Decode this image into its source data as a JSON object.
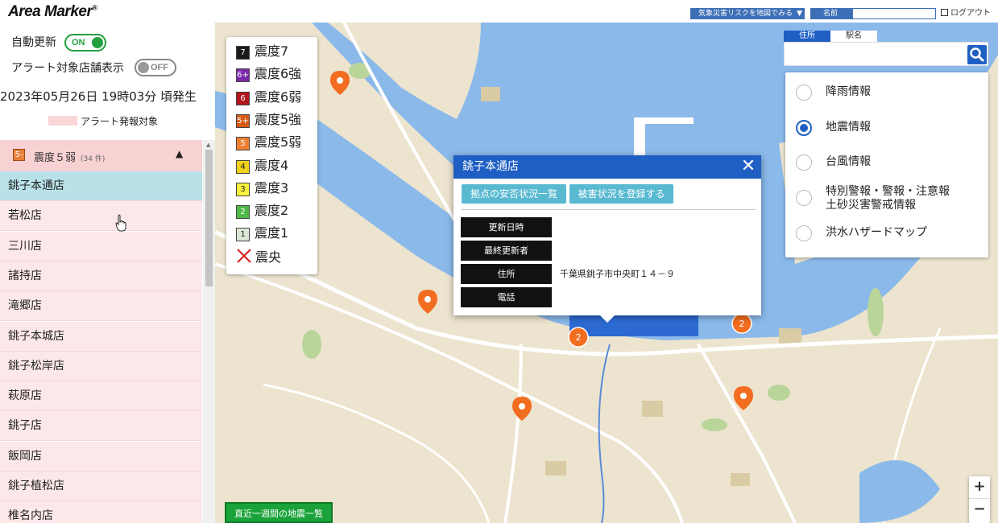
{
  "app": {
    "logo": "Area Marker",
    "logo_mark": "®"
  },
  "header": {
    "risk_map_label": "気象災害リスクを地図でみる",
    "name_label": "名前",
    "name_value": "",
    "logout_label": "ログアウト"
  },
  "sidebar": {
    "auto_update_label": "自動更新",
    "auto_update_state": "ON",
    "alert_display_label": "アラート対象店舗表示",
    "alert_display_state": "OFF",
    "occurred_at": "2023年05月26日 19時03分 頃発生",
    "alert_legend_label": "アラート発報対象",
    "group": {
      "badge": "5-",
      "label": "震度５弱",
      "count": "(34 件)"
    },
    "stores": [
      "銚子本通店",
      "若松店",
      "三川店",
      "諸持店",
      "滝郷店",
      "銚子本城店",
      "銚子松岸店",
      "萩原店",
      "銚子店",
      "飯岡店",
      "銚子植松店",
      "椎名内店"
    ],
    "selected_index": 0
  },
  "intensity_legend": [
    {
      "badge": "7",
      "label": "震度7",
      "color": "#1a1a1a"
    },
    {
      "badge": "6+",
      "label": "震度6強",
      "color": "#7a2aa8"
    },
    {
      "badge": "6",
      "label": "震度6弱",
      "color": "#b3151d"
    },
    {
      "badge": "5+",
      "label": "震度5強",
      "color": "#d65a14"
    },
    {
      "badge": "5",
      "label": "震度5弱",
      "color": "#f08030"
    },
    {
      "badge": "4",
      "label": "震度4",
      "color": "#f1d21a"
    },
    {
      "badge": "3",
      "label": "震度3",
      "color": "#f8f23a"
    },
    {
      "badge": "2",
      "label": "震度2",
      "color": "#4fb848"
    },
    {
      "badge": "1",
      "label": "震度1",
      "color": "#d8e8d4"
    },
    {
      "badge": "",
      "label": "震央",
      "color": "#d42020"
    }
  ],
  "popup": {
    "title": "銚子本通店",
    "btn_safety": "拠点の安否状況一覧",
    "btn_damage": "被害状況を登録する",
    "rows": [
      {
        "label": "更新日時",
        "value": ""
      },
      {
        "label": "最終更新者",
        "value": ""
      },
      {
        "label": "住所",
        "value": "千葉県銚子市中央町１４－９"
      },
      {
        "label": "電話",
        "value": ""
      }
    ]
  },
  "search": {
    "tab_address": "住所",
    "tab_station": "駅名",
    "query": ""
  },
  "info_options": [
    {
      "label": "降雨情報",
      "selected": false
    },
    {
      "label": "地震情報",
      "selected": true
    },
    {
      "label": "台風情報",
      "selected": false
    },
    {
      "label": "特別警報・警報・注意報\n土砂災害警戒情報",
      "selected": false
    },
    {
      "label": "洪水ハザードマップ",
      "selected": false
    }
  ],
  "map": {
    "cluster_labels": [
      "2",
      "2"
    ],
    "zoom_in": "+",
    "zoom_out": "−"
  },
  "weekly_button": "直近一週間の地震一覧",
  "colors": {
    "brand_blue": "#1f5fc4",
    "alert_pink": "#f9d6d8",
    "selected_teal": "#b8e1e8",
    "marker_orange": "#f26d1f",
    "green": "#1aa33a"
  }
}
